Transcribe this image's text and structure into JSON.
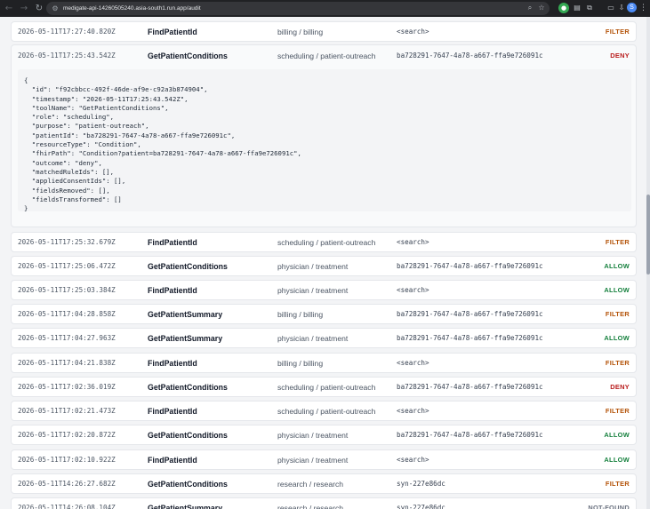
{
  "browser": {
    "url": "medigate-api-14260505240.asia-south1.run.app/audit",
    "profile_initial": "S"
  },
  "colors": {
    "filter": "#b45309",
    "deny": "#b91c1c",
    "allow": "#15803d",
    "not_found": "#6b7280"
  },
  "entries": [
    {
      "timestamp": "2026-05-11T17:27:40.820Z",
      "tool": "FindPatientId",
      "role_purpose": "billing / billing",
      "resource": "<search>",
      "outcome": "FILTER",
      "outcome_class": "filter"
    },
    {
      "timestamp": "2026-05-11T17:25:43.542Z",
      "tool": "GetPatientConditions",
      "role_purpose": "scheduling / patient-outreach",
      "resource": "ba728291-7647-4a78-a667-ffa9e726091c",
      "outcome": "DENY",
      "outcome_class": "deny",
      "expanded": true
    },
    {
      "timestamp": "2026-05-11T17:25:32.679Z",
      "tool": "FindPatientId",
      "role_purpose": "scheduling / patient-outreach",
      "resource": "<search>",
      "outcome": "FILTER",
      "outcome_class": "filter"
    },
    {
      "timestamp": "2026-05-11T17:25:06.472Z",
      "tool": "GetPatientConditions",
      "role_purpose": "physician / treatment",
      "resource": "ba728291-7647-4a78-a667-ffa9e726091c",
      "outcome": "ALLOW",
      "outcome_class": "allow"
    },
    {
      "timestamp": "2026-05-11T17:25:03.384Z",
      "tool": "FindPatientId",
      "role_purpose": "physician / treatment",
      "resource": "<search>",
      "outcome": "ALLOW",
      "outcome_class": "allow"
    },
    {
      "timestamp": "2026-05-11T17:04:28.858Z",
      "tool": "GetPatientSummary",
      "role_purpose": "billing / billing",
      "resource": "ba728291-7647-4a78-a667-ffa9e726091c",
      "outcome": "FILTER",
      "outcome_class": "filter"
    },
    {
      "timestamp": "2026-05-11T17:04:27.963Z",
      "tool": "GetPatientSummary",
      "role_purpose": "physician / treatment",
      "resource": "ba728291-7647-4a78-a667-ffa9e726091c",
      "outcome": "ALLOW",
      "outcome_class": "allow"
    },
    {
      "timestamp": "2026-05-11T17:04:21.838Z",
      "tool": "FindPatientId",
      "role_purpose": "billing / billing",
      "resource": "<search>",
      "outcome": "FILTER",
      "outcome_class": "filter"
    },
    {
      "timestamp": "2026-05-11T17:02:36.019Z",
      "tool": "GetPatientConditions",
      "role_purpose": "scheduling / patient-outreach",
      "resource": "ba728291-7647-4a78-a667-ffa9e726091c",
      "outcome": "DENY",
      "outcome_class": "deny"
    },
    {
      "timestamp": "2026-05-11T17:02:21.473Z",
      "tool": "FindPatientId",
      "role_purpose": "scheduling / patient-outreach",
      "resource": "<search>",
      "outcome": "FILTER",
      "outcome_class": "filter"
    },
    {
      "timestamp": "2026-05-11T17:02:20.872Z",
      "tool": "GetPatientConditions",
      "role_purpose": "physician / treatment",
      "resource": "ba728291-7647-4a78-a667-ffa9e726091c",
      "outcome": "ALLOW",
      "outcome_class": "allow"
    },
    {
      "timestamp": "2026-05-11T17:02:10.922Z",
      "tool": "FindPatientId",
      "role_purpose": "physician / treatment",
      "resource": "<search>",
      "outcome": "ALLOW",
      "outcome_class": "allow"
    },
    {
      "timestamp": "2026-05-11T14:26:27.682Z",
      "tool": "GetPatientConditions",
      "role_purpose": "research / research",
      "resource": "syn-227e86dc",
      "outcome": "FILTER",
      "outcome_class": "filter"
    },
    {
      "timestamp": "2026-05-11T14:26:08.104Z",
      "tool": "GetPatientSummary",
      "role_purpose": "research / research",
      "resource": "syn-227e86dc",
      "outcome": "NOT-FOUND",
      "outcome_class": "notfound"
    }
  ],
  "detail_json": "{\n  \"id\": \"f92cbbcc-492f-46de-af9e-c92a3b874904\",\n  \"timestamp\": \"2026-05-11T17:25:43.542Z\",\n  \"toolName\": \"GetPatientConditions\",\n  \"role\": \"scheduling\",\n  \"purpose\": \"patient-outreach\",\n  \"patientId\": \"ba728291-7647-4a78-a667-ffa9e726091c\",\n  \"resourceType\": \"Condition\",\n  \"fhirPath\": \"Condition?patient=ba728291-7647-4a78-a667-ffa9e726091c\",\n  \"outcome\": \"deny\",\n  \"matchedRuleIds\": [],\n  \"appliedConsentIds\": [],\n  \"fieldsRemoved\": [],\n  \"fieldsTransformed\": []\n}"
}
